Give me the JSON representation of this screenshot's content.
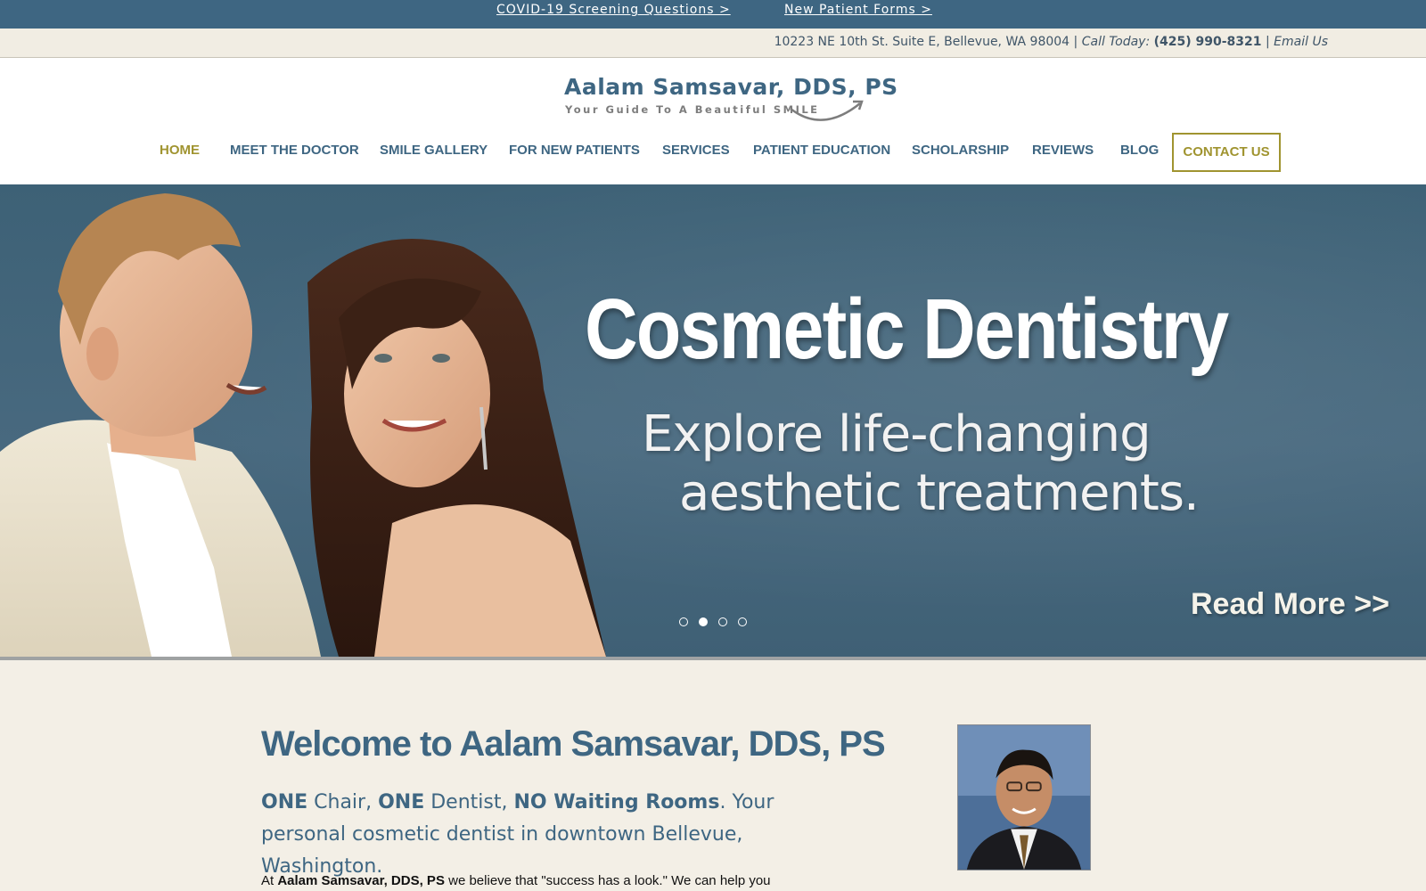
{
  "topbar": {
    "covid_link": "COVID-19 Screening Questions >",
    "forms_link": "New Patient Forms >"
  },
  "address_bar": {
    "address": "10223 NE 10th St. Suite E, Bellevue, WA 98004",
    "separator": " | ",
    "call_label": "Call Today:",
    "phone": "(425) 990-8321",
    "email_label": "Email Us"
  },
  "logo": {
    "title": "Aalam Samsavar, DDS, PS",
    "tagline": "Your Guide To A Beautiful SMILE"
  },
  "nav": {
    "items": [
      {
        "label": "HOME"
      },
      {
        "label": "MEET THE DOCTOR"
      },
      {
        "label": "SMILE GALLERY"
      },
      {
        "label": "FOR NEW PATIENTS"
      },
      {
        "label": "SERVICES"
      },
      {
        "label": "PATIENT EDUCATION"
      },
      {
        "label": "SCHOLARSHIP"
      },
      {
        "label": "REVIEWS"
      },
      {
        "label": "BLOG"
      }
    ],
    "contact": "CONTACT US",
    "active_color": "#a09430"
  },
  "hero": {
    "title": "Cosmetic Dentistry",
    "subtitle_line1": "Explore life-changing",
    "subtitle_line2": "aesthetic treatments.",
    "read_more": "Read More >>",
    "slide_count": 4,
    "active_slide": 2
  },
  "content": {
    "welcome": "Welcome to Aalam Samsavar, DDS, PS",
    "lead": {
      "one1": "ONE",
      "chair": " Chair, ",
      "one2": "ONE",
      "dentist": " Dentist, ",
      "no_wait": "NO Waiting Rooms",
      "rest": ". Your personal cosmetic dentist in downtown Bellevue, Washington."
    },
    "body": {
      "at": "At ",
      "practice": "Aalam Samsavar, DDS, PS",
      "rest": " we believe that \"success has a look.\" We can help you"
    }
  },
  "colors": {
    "brand_blue": "#3e6682",
    "accent_gold": "#a09430",
    "background": "#f3efe6"
  }
}
